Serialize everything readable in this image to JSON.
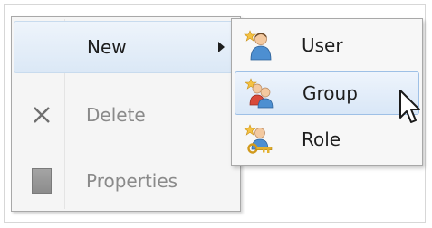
{
  "menu": {
    "items": [
      {
        "label": "New",
        "has_submenu": true,
        "disabled": false
      },
      {
        "label": "Delete",
        "icon": "delete-x-icon",
        "disabled": true
      },
      {
        "label": "Properties",
        "icon": "properties-icon",
        "disabled": true
      }
    ]
  },
  "submenu": {
    "items": [
      {
        "label": "User",
        "icon": "new-user-icon"
      },
      {
        "label": "Group",
        "icon": "new-group-icon",
        "highlighted": true
      },
      {
        "label": "Role",
        "icon": "new-role-icon"
      }
    ]
  },
  "colors": {
    "highlight_bg": "#dbe8f6",
    "highlight_border": "#9ec0e6",
    "disabled_text": "#8a8a8a"
  }
}
